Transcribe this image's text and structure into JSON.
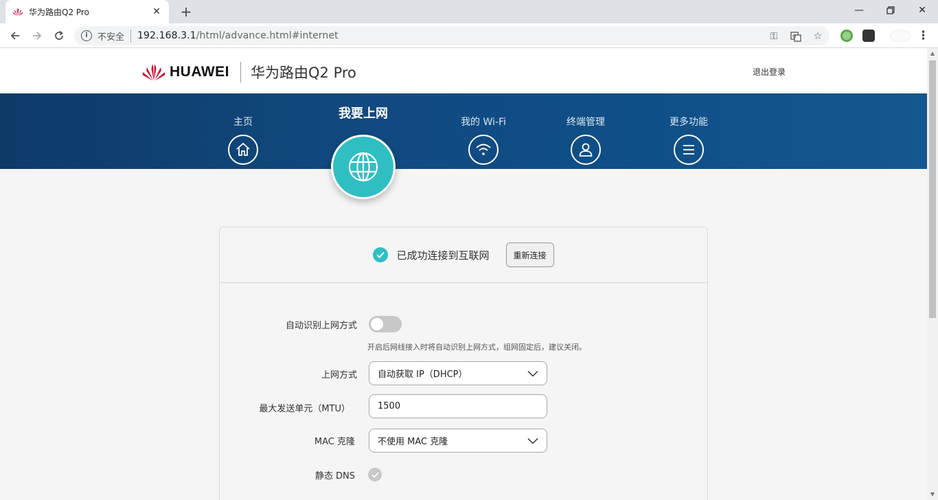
{
  "browser": {
    "tab_title": "华为路由Q2 Pro",
    "security_label": "不安全",
    "url_host": "192.168.3.1",
    "url_path": "/html/advance.html#internet"
  },
  "header": {
    "brand": "HUAWEI",
    "product": "华为路由Q2 Pro",
    "logout": "退出登录"
  },
  "nav": {
    "items": [
      {
        "label": "主页",
        "icon": "home-icon"
      },
      {
        "label": "我要上网",
        "icon": "globe-icon",
        "active": true
      },
      {
        "label": "我的 Wi-Fi",
        "icon": "wifi-icon"
      },
      {
        "label": "终端管理",
        "icon": "user-icon"
      },
      {
        "label": "更多功能",
        "icon": "menu-icon"
      }
    ]
  },
  "status": {
    "text": "已成功连接到互联网",
    "reconnect_label": "重新连接"
  },
  "form": {
    "auto_detect_label": "自动识别上网方式",
    "auto_detect_enabled": false,
    "auto_detect_hint": "开启后网线接入时将自动识别上网方式，组网固定后，建议关闭。",
    "mode_label": "上网方式",
    "mode_value": "自动获取 IP（DHCP）",
    "mtu_label": "最大发送单元（MTU）",
    "mtu_value": "1500",
    "mac_label": "MAC 克隆",
    "mac_value": "不使用 MAC 克隆",
    "dns_label": "静态 DNS",
    "dns_enabled": false
  },
  "colors": {
    "accent": "#2fbfc3",
    "nav_band": "#114a80",
    "brand_red": "#cf0a2c"
  }
}
